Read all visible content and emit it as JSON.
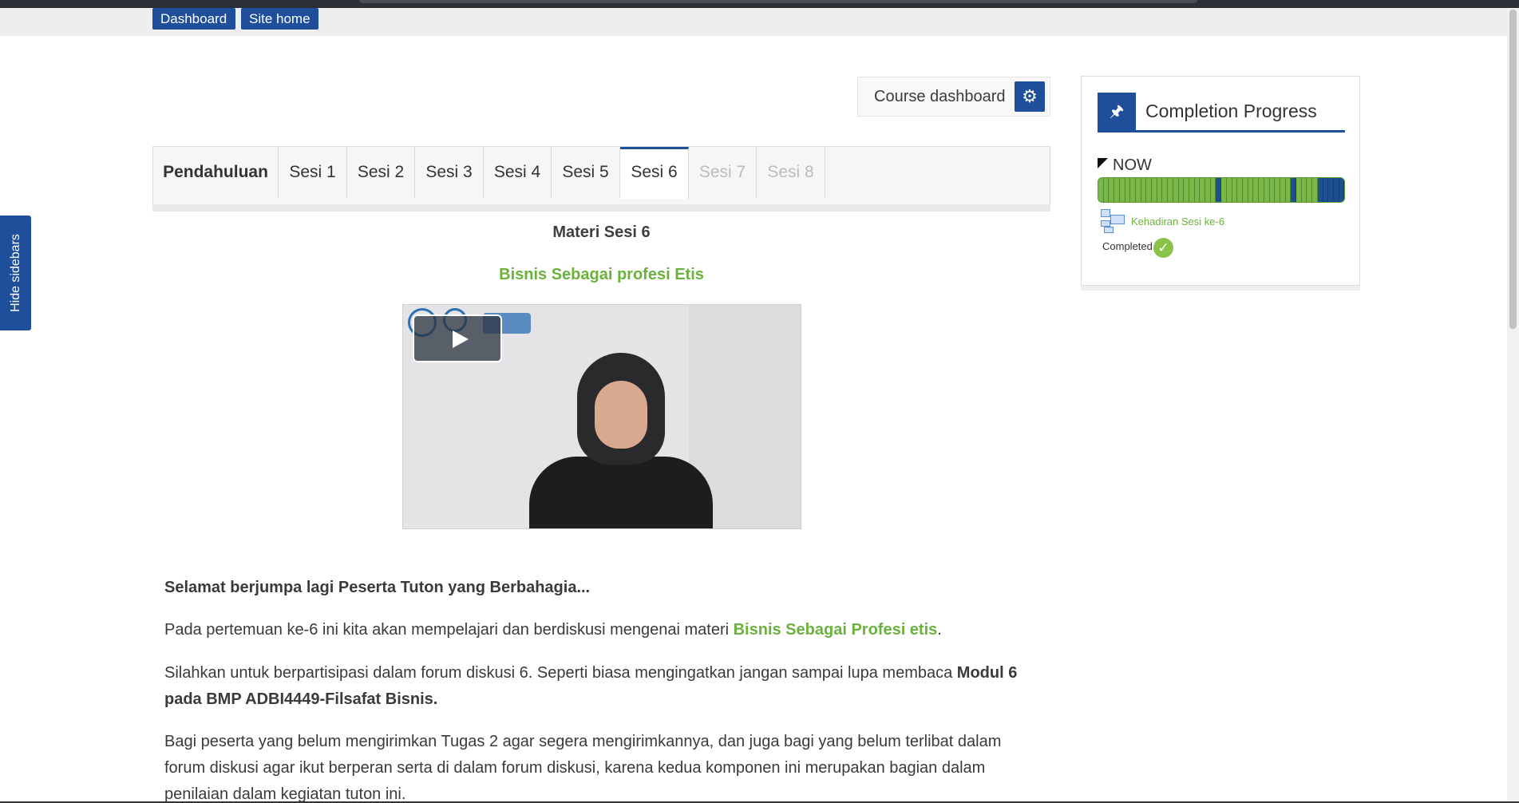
{
  "breadcrumbs": [
    "Dashboard",
    "Site home"
  ],
  "hide_sidebars": "Hide sidebars",
  "course_dashboard": {
    "label": "Course dashboard"
  },
  "tabs": [
    {
      "label": "Pendahuluan",
      "state": "bold"
    },
    {
      "label": "Sesi 1",
      "state": "normal"
    },
    {
      "label": "Sesi 2",
      "state": "normal"
    },
    {
      "label": "Sesi 3",
      "state": "normal"
    },
    {
      "label": "Sesi 4",
      "state": "normal"
    },
    {
      "label": "Sesi 5",
      "state": "normal"
    },
    {
      "label": "Sesi 6",
      "state": "active"
    },
    {
      "label": "Sesi 7",
      "state": "disabled"
    },
    {
      "label": "Sesi 8",
      "state": "disabled"
    }
  ],
  "main": {
    "materi_title": "Materi Sesi 6",
    "topic_title": "Bisnis Sebagai profesi Etis",
    "greeting": "Selamat berjumpa lagi Peserta Tuton yang Berbahagia...",
    "p2_pre": "Pada pertemuan ke-6 ini kita akan mempelajari dan berdiskusi mengenai materi ",
    "p2_link": "Bisnis Sebagai Profesi etis",
    "p2_post": ".",
    "p3_pre": "Silahkan untuk berpartisipasi dalam forum diskusi 6. Seperti biasa mengingatkan jangan sampai lupa membaca ",
    "p3_bold": "Modul 6 pada BMP ADBI4449-Filsafat Bisnis.",
    "p4": "Bagi peserta  yang belum mengirimkan Tugas 2 agar segera mengirimkannya, dan juga bagi yang belum  terlibat dalam forum diskusi agar ikut berperan serta di dalam forum diskusi, karena kedua komponen ini merupakan bagian dalam penilaian dalam kegiatan tuton ini."
  },
  "completion": {
    "title": "Completion Progress",
    "now_label": "NOW",
    "segments_total": 46,
    "completed_color": "#7ab648",
    "submitted_color": "#1e4f8f",
    "blue_segment_indexes": [
      22,
      36,
      41,
      42,
      43,
      44,
      45
    ],
    "activity_label": "Kehadiran Sesi ke-6",
    "status_label": "Completed"
  },
  "colors": {
    "brand_blue": "#1f4f9b",
    "accent_green": "#6bb23d"
  },
  "icons": {
    "gear": "gear-icon",
    "pin": "pin-icon",
    "check": "check-circle-icon",
    "play": "play-icon",
    "activity": "attendance-icon"
  }
}
